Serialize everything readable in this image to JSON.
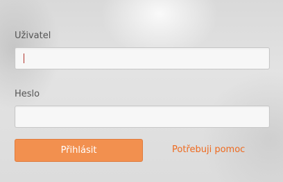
{
  "form": {
    "username": {
      "label": "Uživatel",
      "value": "",
      "placeholder": ""
    },
    "password": {
      "label": "Heslo",
      "value": "",
      "placeholder": ""
    },
    "login_button": "Přihlásit",
    "help_link": "Potřebuji pomoc"
  },
  "colors": {
    "accent": "#f2904f",
    "link": "#ee6a1f",
    "caret": "#b0332b"
  }
}
